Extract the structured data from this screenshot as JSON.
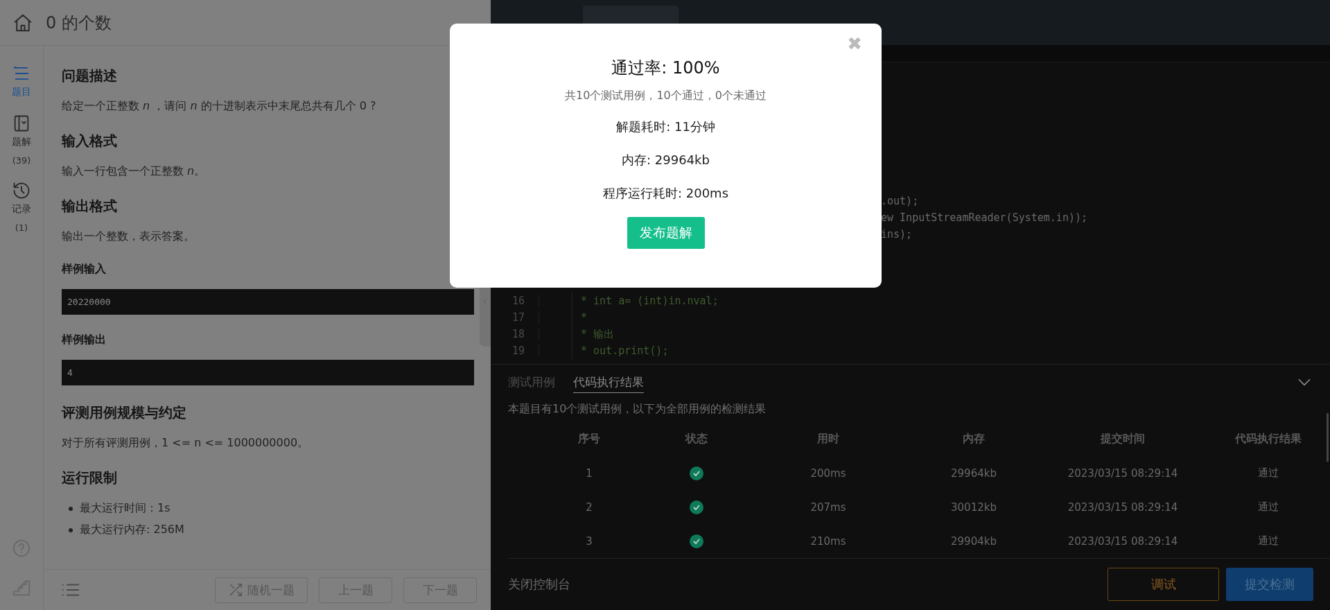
{
  "problem": {
    "title": "0 的个数"
  },
  "sidebar": {
    "items": [
      {
        "label": "题目",
        "selected": true
      },
      {
        "label": "题解",
        "count": "(39)",
        "selected": false
      },
      {
        "label": "记录",
        "count": "(1)",
        "selected": false
      }
    ]
  },
  "content": [
    {
      "kind": "heading",
      "text": "问题描述"
    },
    {
      "kind": "paragraph",
      "text": "给定一个正整数 *n* ，请问 *n* 的十进制表示中末尾总共有几个 0 ?"
    },
    {
      "kind": "heading",
      "text": "输入格式"
    },
    {
      "kind": "paragraph",
      "text": "输入一行包含一个正整数 *n*。"
    },
    {
      "kind": "heading",
      "text": "输出格式"
    },
    {
      "kind": "paragraph",
      "text": "输出一个整数，表示答案。"
    },
    {
      "kind": "subheading",
      "text": "样例输入"
    },
    {
      "kind": "code",
      "text": "20220000"
    },
    {
      "kind": "subheading",
      "text": "样例输出"
    },
    {
      "kind": "code",
      "text": "4"
    },
    {
      "kind": "heading",
      "text": "评测用例规模与约定"
    },
    {
      "kind": "paragraph",
      "text": "对于所有评测用例，1 <= n <= 1000000000。"
    },
    {
      "kind": "heading",
      "text": "运行限制"
    },
    {
      "kind": "bullet",
      "text": "最大运行时间：1s"
    },
    {
      "kind": "bullet",
      "text": "最大运行内存: 256M"
    }
  ],
  "footer_buttons": [
    {
      "label": "随机一题"
    },
    {
      "label": "上一题"
    },
    {
      "label": "下一题"
    }
  ],
  "editor": {
    "lines": [
      {
        "kind": "fragment",
        "text": ".out);"
      },
      {
        "kind": "fragment",
        "text": "ew InputStreamReader(System.in));"
      },
      {
        "kind": "fragment",
        "text": "ins);"
      },
      {
        "kind": "blank"
      },
      {
        "kind": "blank"
      },
      {
        "kind": "blank"
      },
      {
        "kind": "comment",
        "number": "16",
        "text": "* int a= (int)in.nval;"
      },
      {
        "kind": "comment",
        "number": "17",
        "text": "*"
      },
      {
        "kind": "comment",
        "number": "18",
        "text": "* 输出"
      },
      {
        "kind": "comment",
        "number": "19",
        "text": "* out.print();"
      }
    ]
  },
  "console": {
    "tabs": [
      {
        "label": "测试用例",
        "selected": false
      },
      {
        "label": "代码执行结果",
        "selected": true
      }
    ],
    "summary": "本题目有10个测试用例，以下为全部用例的检测结果",
    "columns": [
      "序号",
      "状态",
      "用时",
      "内存",
      "提交时间",
      "代码执行结果"
    ],
    "rows": [
      {
        "index": "1",
        "passed": true,
        "time": "200ms",
        "memory": "29964kb",
        "submitted": "2023/03/15 08:29:14",
        "result": "通过"
      },
      {
        "index": "2",
        "passed": true,
        "time": "207ms",
        "memory": "30012kb",
        "submitted": "2023/03/15 08:29:14",
        "result": "通过"
      },
      {
        "index": "3",
        "passed": true,
        "time": "210ms",
        "memory": "29904kb",
        "submitted": "2023/03/15 08:29:14",
        "result": "通过"
      }
    ],
    "close_label": "关闭控制台",
    "debug_button": "调试",
    "submit_button": "提交检测"
  },
  "modal": {
    "close": "✖",
    "title": "通过率: 100%",
    "subtitle": "共10个测试用例，10个通过，0个未通过",
    "stats": [
      "解题耗时: 11分钟",
      "内存: 29964kb",
      "程序运行耗时: 200ms"
    ],
    "button": "发布题解"
  }
}
